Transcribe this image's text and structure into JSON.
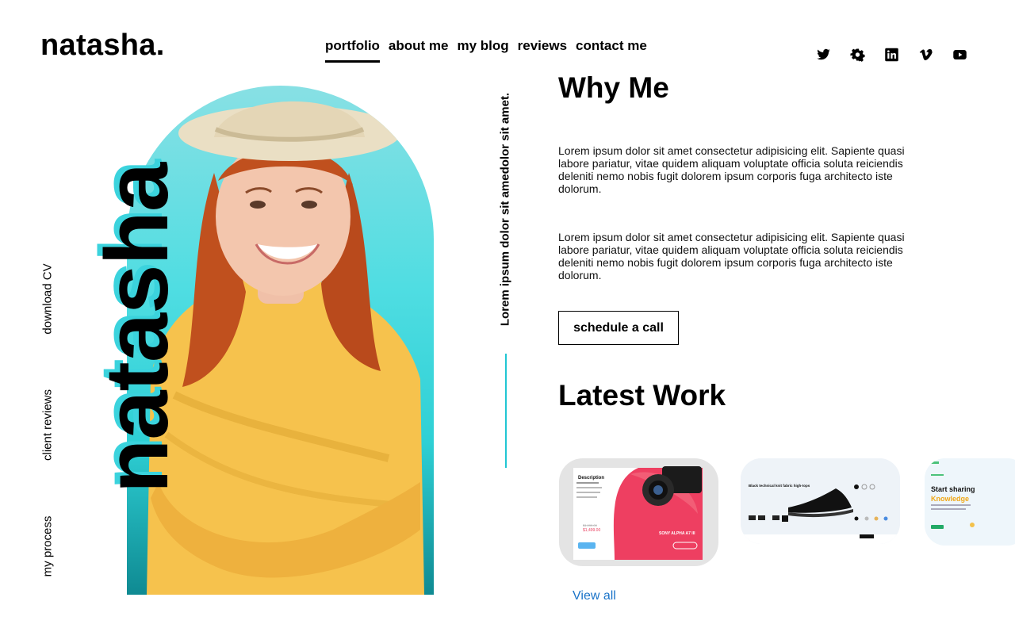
{
  "brand": {
    "logo": "natasha."
  },
  "nav": {
    "items": [
      {
        "label": "portfolio",
        "active": true
      },
      {
        "label": "about me",
        "active": false
      },
      {
        "label": "my blog",
        "active": false
      },
      {
        "label": "reviews",
        "active": false
      },
      {
        "label": "contact me",
        "active": false
      }
    ]
  },
  "social": [
    "twitter-icon",
    "gear-icon",
    "linkedin-icon",
    "vimeo-icon",
    "youtube-icon"
  ],
  "side_links": [
    "download CV",
    "client reviews",
    "my process"
  ],
  "hero": {
    "big_name": "natasha",
    "vertical_text": "Lorem ipsum dolor sit amedolor sit amet."
  },
  "why_me": {
    "title": "Why Me",
    "paragraph_1": "Lorem ipsum dolor sit amet consectetur adipisicing elit. Sapiente quasi labore pariatur, vitae quidem aliquam voluptate officia soluta reiciendis deleniti nemo nobis fugit dolorem ipsum corporis fuga architecto iste dolorum.",
    "paragraph_2": "Lorem ipsum dolor sit amet consectetur adipisicing elit. Sapiente quasi labore pariatur, vitae quidem aliquam voluptate officia soluta reiciendis deleniti nemo nobis fugit dolorem ipsum corporis fuga architecto iste dolorum.",
    "cta": "schedule a call"
  },
  "latest_work": {
    "title": "Latest Work",
    "cards": [
      {
        "heading": "Description",
        "old_price": "$1,999.00",
        "price": "$1,499.00",
        "product": "SONY ALPHA A7 III"
      },
      {
        "heading": "Black technical knit fabric high-tops"
      },
      {
        "heading": "Start sharing",
        "highlight": "Knowledge"
      }
    ],
    "view_all": "View all"
  },
  "colors": {
    "accent": "#3bd3dd",
    "link": "#1a73c8",
    "sweater": "#f6c24d",
    "hair": "#c0501e"
  }
}
